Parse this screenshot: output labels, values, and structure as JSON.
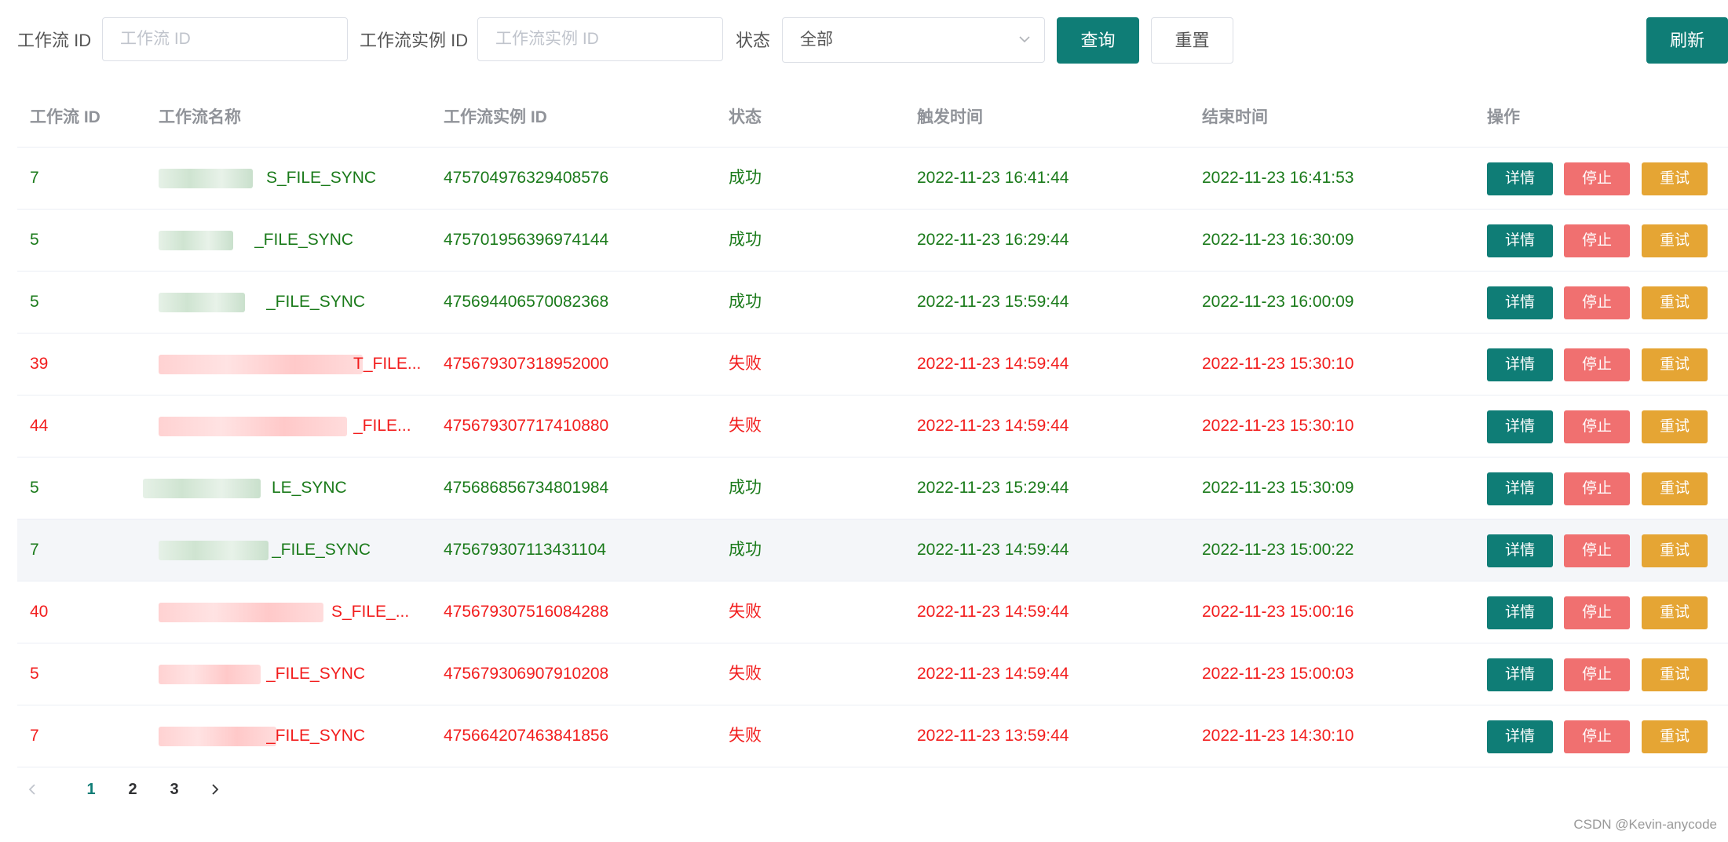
{
  "filters": {
    "workflow_id_label": "工作流 ID",
    "workflow_id_placeholder": "工作流 ID",
    "instance_id_label": "工作流实例 ID",
    "instance_id_placeholder": "工作流实例 ID",
    "status_label": "状态",
    "status_value": "全部",
    "query_button": "查询",
    "reset_button": "重置",
    "refresh_button": "刷新"
  },
  "table": {
    "columns": [
      "工作流 ID",
      "工作流名称",
      "工作流实例 ID",
      "状态",
      "触发时间",
      "结束时间",
      "操作"
    ],
    "rows": [
      {
        "id": "7",
        "name_visible": "S_FILE_SYNC",
        "instance_id": "475704976329408576",
        "status": "成功",
        "trigger_time": "2022-11-23 16:41:44",
        "end_time": "2022-11-23 16:41:53",
        "state": "ok"
      },
      {
        "id": "5",
        "name_visible": "_FILE_SYNC",
        "instance_id": "475701956396974144",
        "status": "成功",
        "trigger_time": "2022-11-23 16:29:44",
        "end_time": "2022-11-23 16:30:09",
        "state": "ok"
      },
      {
        "id": "5",
        "name_visible": "_FILE_SYNC",
        "instance_id": "475694406570082368",
        "status": "成功",
        "trigger_time": "2022-11-23 15:59:44",
        "end_time": "2022-11-23 16:00:09",
        "state": "ok"
      },
      {
        "id": "39",
        "name_visible": "T_FILE...",
        "instance_id": "475679307318952000",
        "status": "失败",
        "trigger_time": "2022-11-23 14:59:44",
        "end_time": "2022-11-23 15:30:10",
        "state": "fail"
      },
      {
        "id": "44",
        "name_visible": "_FILE...",
        "instance_id": "475679307717410880",
        "status": "失败",
        "trigger_time": "2022-11-23 14:59:44",
        "end_time": "2022-11-23 15:30:10",
        "state": "fail"
      },
      {
        "id": "5",
        "name_visible": "LE_SYNC",
        "instance_id": "475686856734801984",
        "status": "成功",
        "trigger_time": "2022-11-23 15:29:44",
        "end_time": "2022-11-23 15:30:09",
        "state": "ok"
      },
      {
        "id": "7",
        "name_visible": "_FILE_SYNC",
        "instance_id": "475679307113431104",
        "status": "成功",
        "trigger_time": "2022-11-23 14:59:44",
        "end_time": "2022-11-23 15:00:22",
        "state": "ok",
        "hover": true
      },
      {
        "id": "40",
        "name_visible": "S_FILE_...",
        "instance_id": "475679307516084288",
        "status": "失败",
        "trigger_time": "2022-11-23 14:59:44",
        "end_time": "2022-11-23 15:00:16",
        "state": "fail"
      },
      {
        "id": "5",
        "name_visible": "_FILE_SYNC",
        "instance_id": "475679306907910208",
        "status": "失败",
        "trigger_time": "2022-11-23 14:59:44",
        "end_time": "2022-11-23 15:00:03",
        "state": "fail"
      },
      {
        "id": "7",
        "name_visible": "_FILE_SYNC",
        "instance_id": "475664207463841856",
        "status": "失败",
        "trigger_time": "2022-11-23 13:59:44",
        "end_time": "2022-11-23 14:30:10",
        "state": "fail"
      }
    ],
    "actions": {
      "detail": "详情",
      "stop": "停止",
      "retry": "重试"
    }
  },
  "pagination": {
    "pages": [
      "1",
      "2",
      "3"
    ],
    "current": "1",
    "prev_icon": "chevron-left-icon",
    "next_icon": "chevron-right-icon"
  },
  "watermark": "CSDN @Kevin-anycode",
  "colors": {
    "primary": "#0f7d76",
    "success_text": "#1a7a1a",
    "fail_text": "#f21d1d",
    "stop_button": "#f07070",
    "retry_button": "#e5a534"
  }
}
